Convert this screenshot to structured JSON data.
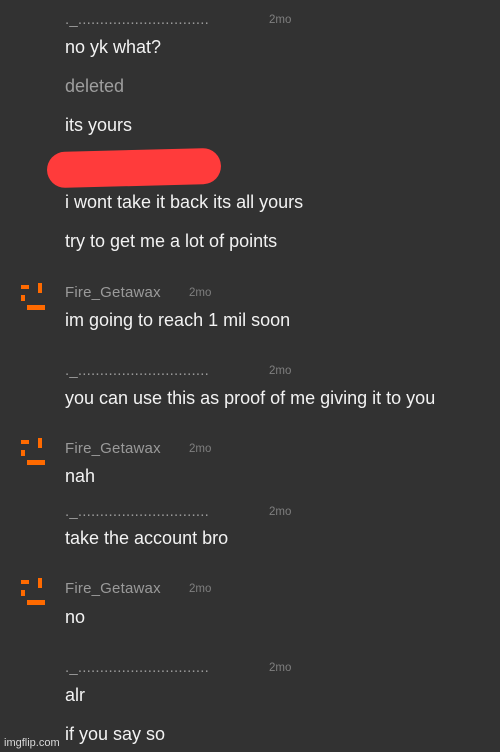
{
  "watermark": "imgflip.com",
  "colors": {
    "background": "#323232",
    "avatar_accent": "#ff6a00",
    "redaction": "#ff3b3b"
  },
  "avatar_icon": "orange-pixel-face-icon",
  "groups": [
    {
      "author": "._..............................",
      "time": "2mo",
      "messages": [
        "no yk what?",
        "deleted",
        "its yours",
        "i wont take it back its all yours",
        "try to get me a lot of points"
      ]
    },
    {
      "author": "Fire_Getawax",
      "time": "2mo",
      "messages": [
        "im going to reach 1 mil soon"
      ]
    },
    {
      "author": "._..............................",
      "time": "2mo",
      "messages": [
        "you can use this as proof of me giving it to you"
      ]
    },
    {
      "author": "Fire_Getawax",
      "time": "2mo",
      "messages": [
        "nah"
      ]
    },
    {
      "author": "._..............................",
      "time": "2mo",
      "messages": [
        "take the account bro"
      ]
    },
    {
      "author": "Fire_Getawax",
      "time": "2mo",
      "messages": [
        "no"
      ]
    },
    {
      "author": "._..............................",
      "time": "2mo",
      "messages": [
        "alr",
        "if you say so"
      ]
    }
  ]
}
